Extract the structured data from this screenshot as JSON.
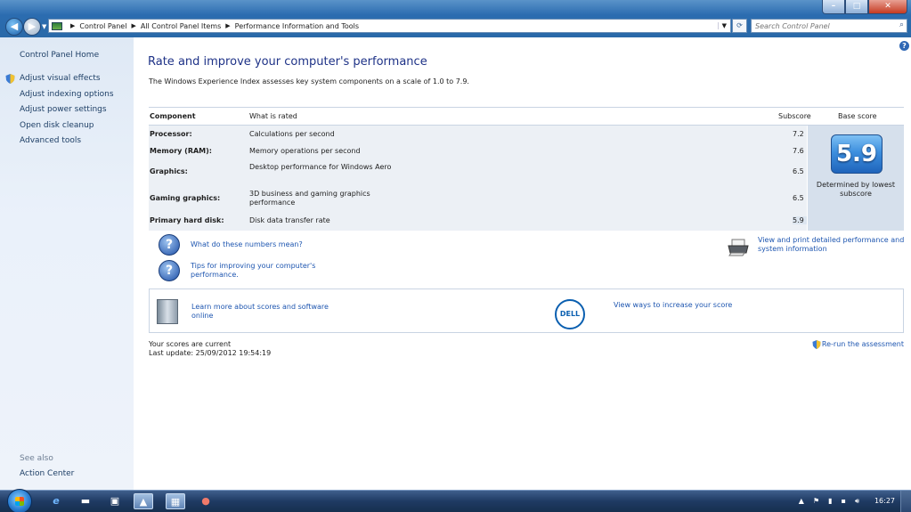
{
  "window": {
    "controls": {
      "minimize": "–",
      "maximize": "□",
      "close": "✕"
    }
  },
  "address_bar": {
    "breadcrumbs": [
      "Control Panel",
      "All Control Panel Items",
      "Performance Information and Tools"
    ],
    "search_placeholder": "Search Control Panel"
  },
  "sidebar": {
    "home": "Control Panel Home",
    "tasks": [
      "Adjust visual effects",
      "Adjust indexing options",
      "Adjust power settings",
      "Open disk cleanup",
      "Advanced tools"
    ],
    "see_also_label": "See also",
    "see_also_items": [
      "Action Center"
    ]
  },
  "main": {
    "title": "Rate and improve your computer's performance",
    "subtitle": "The Windows Experience Index assesses key system components on a scale of 1.0 to 7.9.",
    "table": {
      "headers": {
        "component": "Component",
        "rated": "What is rated",
        "subscore": "Subscore",
        "base": "Base score"
      },
      "rows": [
        {
          "component": "Processor:",
          "rated": "Calculations per second",
          "subscore": "7.2"
        },
        {
          "component": "Memory (RAM):",
          "rated": "Memory operations per second",
          "subscore": "7.6"
        },
        {
          "component": "Graphics:",
          "rated": "Desktop performance for Windows Aero",
          "subscore": "6.5"
        },
        {
          "component": "Gaming graphics:",
          "rated": "3D business and gaming graphics performance",
          "subscore": "6.5"
        },
        {
          "component": "Primary hard disk:",
          "rated": "Disk data transfer rate",
          "subscore": "5.9"
        }
      ],
      "base_score": "5.9",
      "base_caption": "Determined by lowest subscore"
    },
    "links": {
      "numbers_meaning": "What do these numbers mean?",
      "tips": "Tips for improving your computer's performance.",
      "print_details": "View and print detailed performance and system information",
      "learn_more": "Learn more about scores and software online",
      "increase_score": "View ways to increase your score",
      "rerun": "Re-run the assessment"
    },
    "dell_logo": "DELL",
    "status": {
      "current": "Your scores are current",
      "last_update": "Last update: 25/09/2012 19:54:19"
    }
  },
  "taskbar": {
    "clock": "16:27"
  }
}
